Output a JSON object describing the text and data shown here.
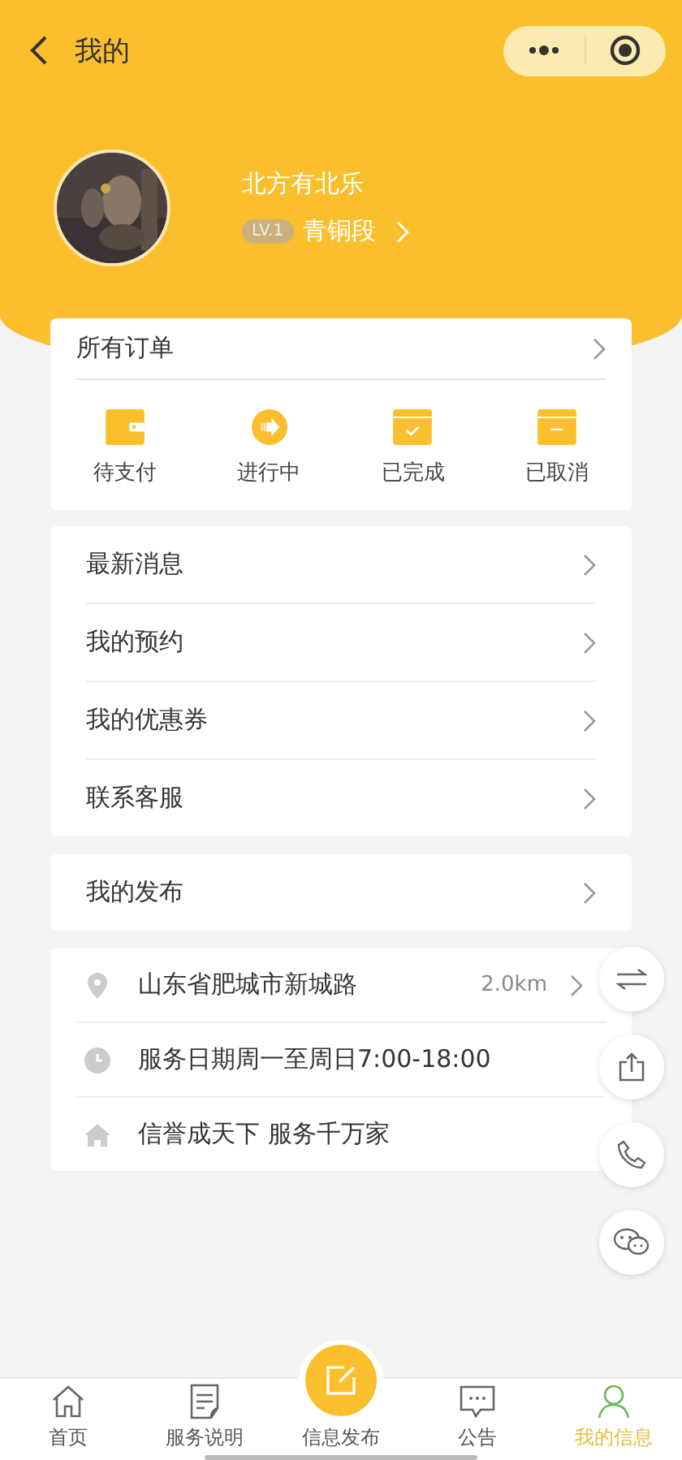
{
  "nav": {
    "title": "我的"
  },
  "profile": {
    "name": "北方有北乐",
    "level_badge": "LV.1",
    "rank": "青铜段"
  },
  "orders": {
    "title": "所有订单",
    "items": [
      {
        "label": "待支付",
        "kind": "wallet"
      },
      {
        "label": "进行中",
        "kind": "progress"
      },
      {
        "label": "已完成",
        "kind": "done"
      },
      {
        "label": "已取消",
        "kind": "cancel"
      }
    ]
  },
  "menu": [
    {
      "label": "最新消息"
    },
    {
      "label": "我的预约"
    },
    {
      "label": "我的优惠券"
    },
    {
      "label": "联系客服"
    }
  ],
  "publish": {
    "label": "我的发布"
  },
  "info": [
    {
      "kind": "location",
      "text": "山东省肥城市新城路",
      "distance": "2.0km",
      "arrow": true
    },
    {
      "kind": "clock",
      "text": "服务日期周一至周日7:00-18:00",
      "arrow": false
    },
    {
      "kind": "home",
      "text": "信誉成天下 服务千万家",
      "arrow": false
    }
  ],
  "float_buttons": [
    {
      "kind": "switch"
    },
    {
      "kind": "share"
    },
    {
      "kind": "phone"
    },
    {
      "kind": "chat"
    }
  ],
  "tabs": [
    {
      "label": "首页",
      "kind": "home",
      "selected": false
    },
    {
      "label": "服务说明",
      "kind": "doc",
      "selected": false
    },
    {
      "label": "信息发布",
      "kind": "center",
      "selected": false
    },
    {
      "label": "公告",
      "kind": "notice",
      "selected": false
    },
    {
      "label": "我的信息",
      "kind": "user",
      "selected": true
    }
  ]
}
